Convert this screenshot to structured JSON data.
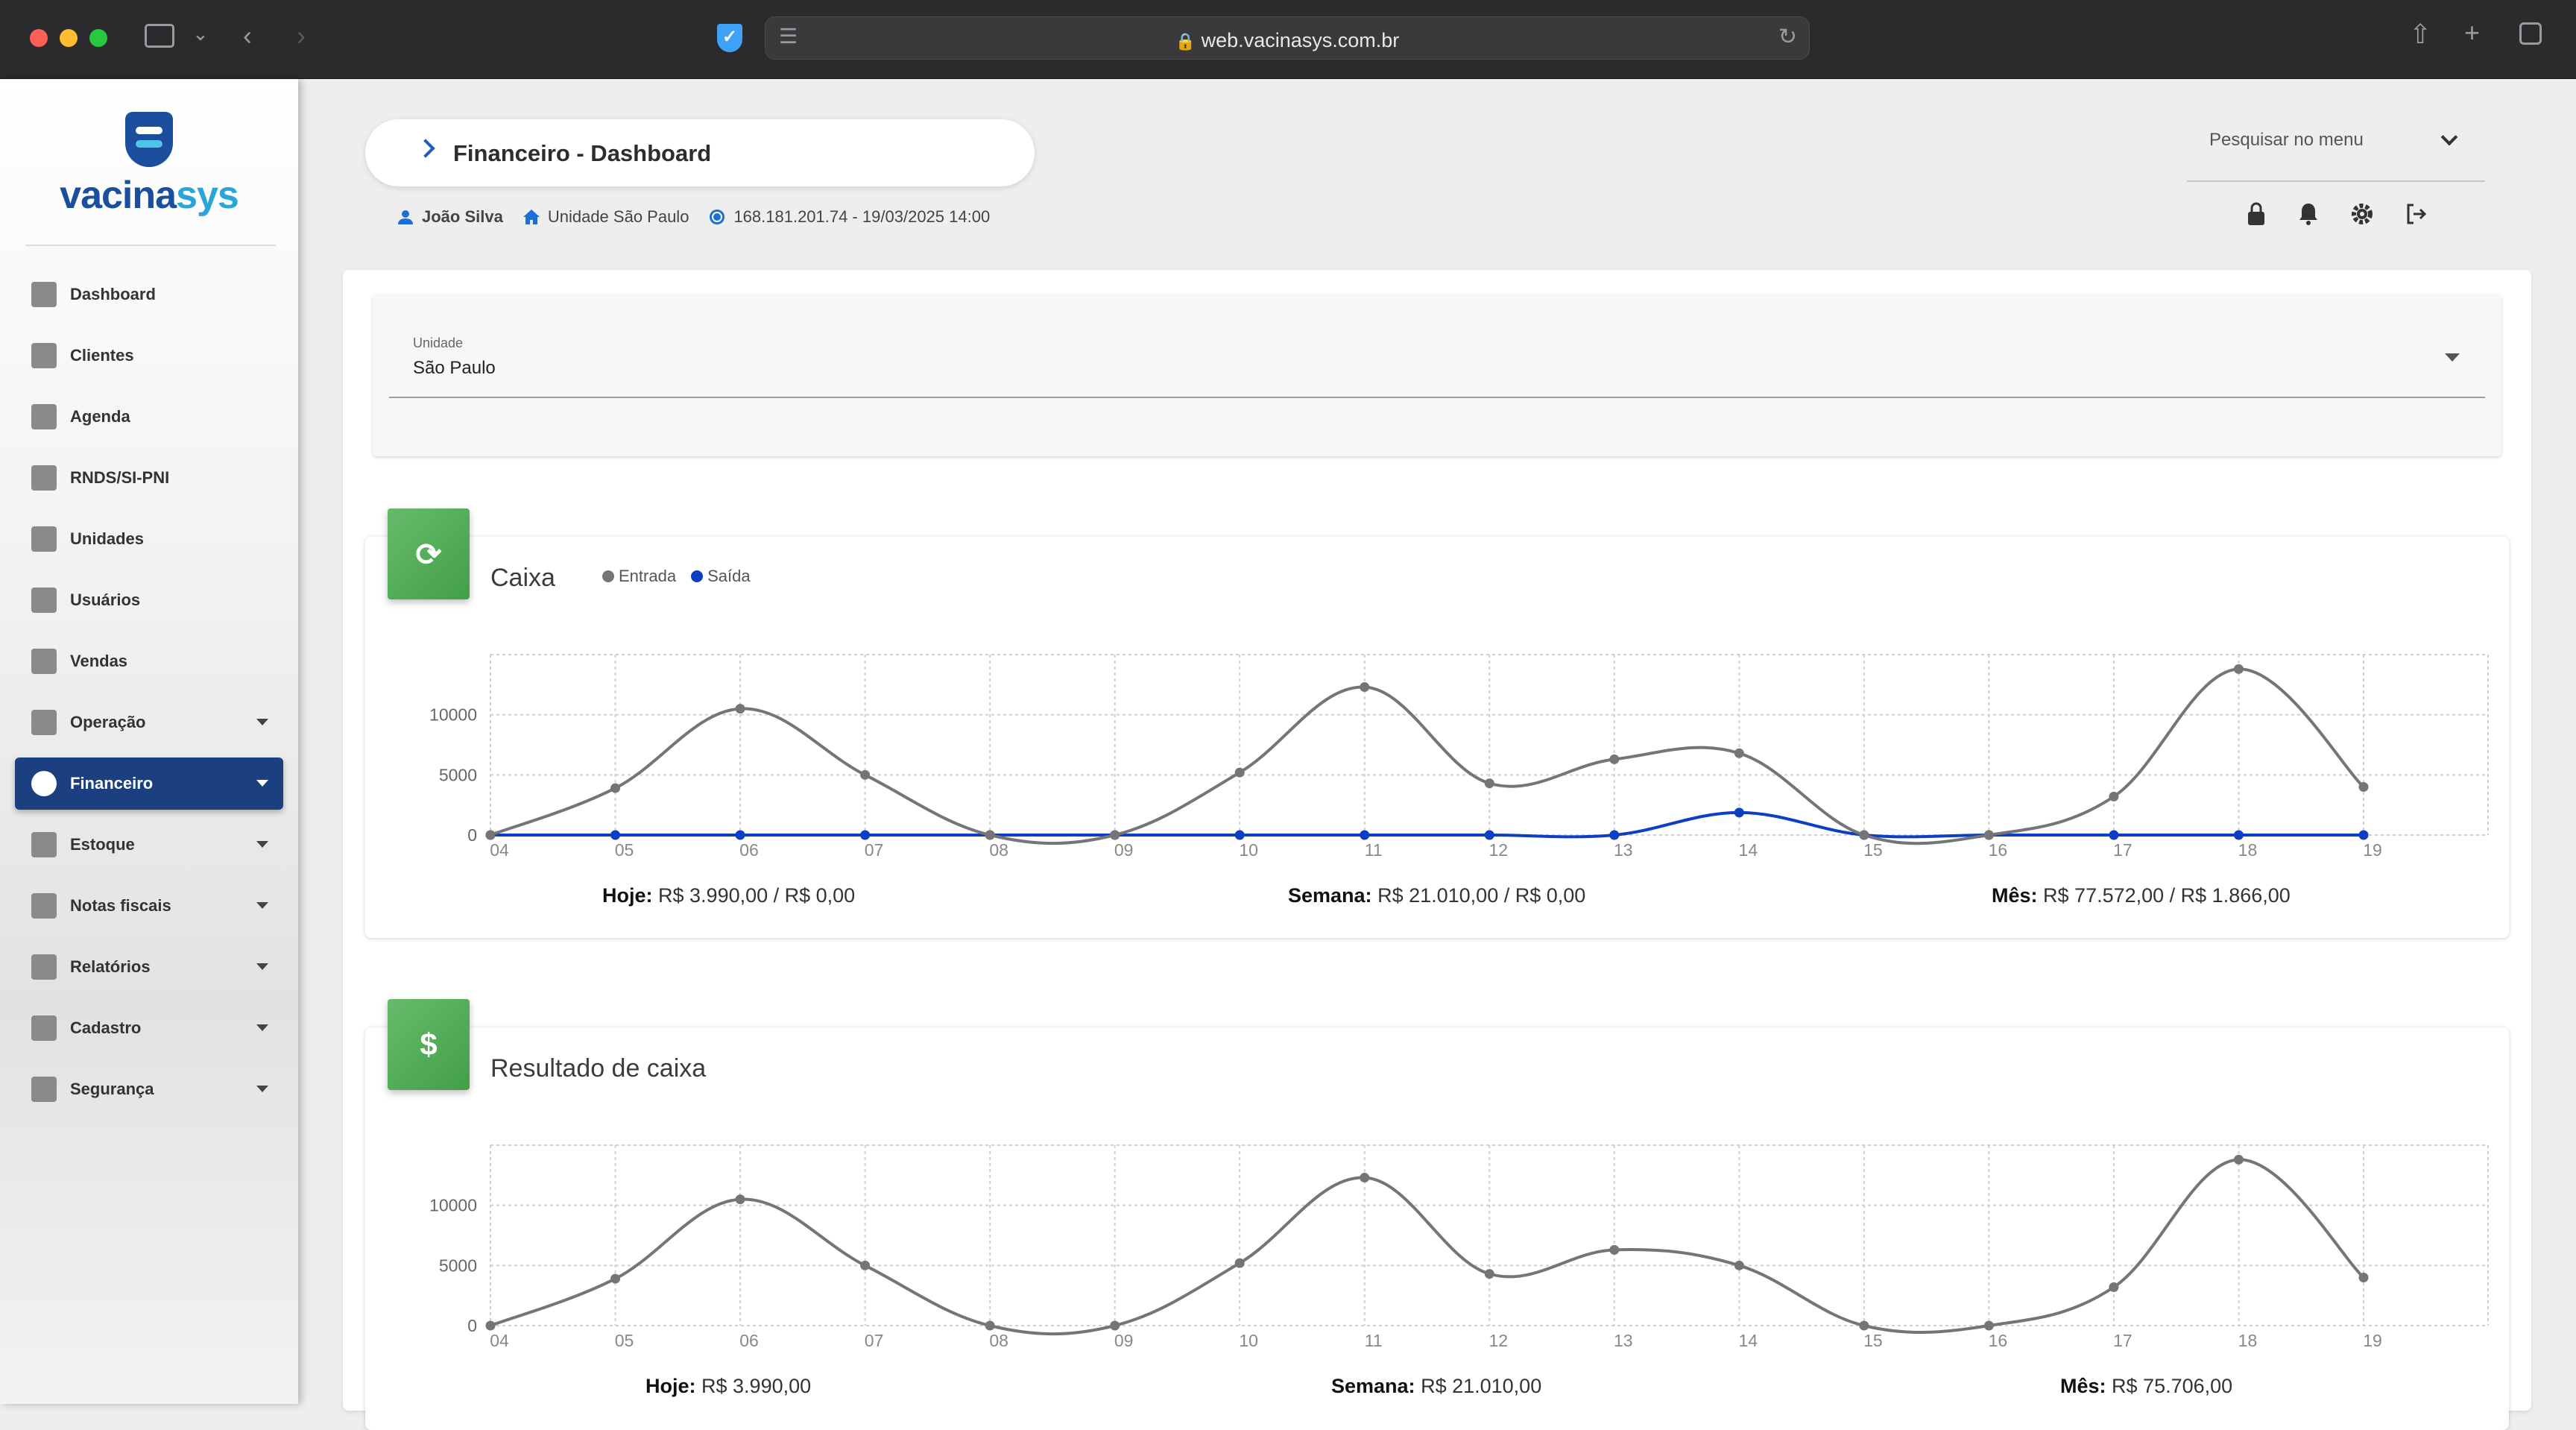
{
  "browser": {
    "url": "web.vacinasys.com.br"
  },
  "logo": {
    "part1": "vacina",
    "part2": "sys"
  },
  "sidebar": {
    "items": [
      {
        "label": "Dashboard"
      },
      {
        "label": "Clientes"
      },
      {
        "label": "Agenda"
      },
      {
        "label": "RNDS/SI-PNI"
      },
      {
        "label": "Unidades"
      },
      {
        "label": "Usuários"
      },
      {
        "label": "Vendas"
      },
      {
        "label": "Operação"
      },
      {
        "label": "Financeiro"
      },
      {
        "label": "Estoque"
      },
      {
        "label": "Notas fiscais"
      },
      {
        "label": "Relatórios"
      },
      {
        "label": "Cadastro"
      },
      {
        "label": "Segurança"
      }
    ],
    "active": "Financeiro"
  },
  "header": {
    "title": "Financeiro - Dashboard",
    "user": "João Silva",
    "unit": "Unidade São Paulo",
    "session": "168.181.201.74 - 19/03/2025 14:00",
    "search_menu_placeholder": "Pesquisar no menu"
  },
  "filter": {
    "unit_label": "Unidade",
    "unit_value": "São Paulo"
  },
  "colors": {
    "entrada": "#757575",
    "saida": "#0d3fc4",
    "badge": "#4caf50",
    "active_nav": "#1c3f80"
  },
  "chart_data": [
    {
      "type": "line",
      "title": "Caixa",
      "categories": [
        "04",
        "05",
        "06",
        "07",
        "08",
        "09",
        "10",
        "11",
        "12",
        "13",
        "14",
        "15",
        "16",
        "17",
        "18",
        "19"
      ],
      "ylim": [
        0,
        15000
      ],
      "yticks": [
        0,
        5000,
        10000
      ],
      "grid": true,
      "legend": "top-left",
      "series": [
        {
          "name": "Entrada",
          "values": [
            0,
            3900,
            10500,
            5000,
            0,
            0,
            5200,
            12300,
            4300,
            6300,
            6800,
            0,
            0,
            3200,
            13800,
            4000
          ]
        },
        {
          "name": "Saída",
          "values": [
            0,
            0,
            0,
            0,
            0,
            0,
            0,
            0,
            0,
            0,
            1866,
            0,
            0,
            0,
            0,
            0
          ]
        }
      ],
      "summary": [
        {
          "label": "Hoje:",
          "value": "R$ 3.990,00 / R$ 0,00"
        },
        {
          "label": "Semana:",
          "value": "R$ 21.010,00 / R$ 0,00"
        },
        {
          "label": "Mês:",
          "value": "R$ 77.572,00 / R$ 1.866,00"
        }
      ]
    },
    {
      "type": "line",
      "title": "Resultado de caixa",
      "categories": [
        "04",
        "05",
        "06",
        "07",
        "08",
        "09",
        "10",
        "11",
        "12",
        "13",
        "14",
        "15",
        "16",
        "17",
        "18",
        "19"
      ],
      "ylim": [
        0,
        15000
      ],
      "yticks": [
        0,
        5000,
        10000
      ],
      "grid": true,
      "series": [
        {
          "values": [
            0,
            3900,
            10500,
            5000,
            0,
            0,
            5200,
            12300,
            4300,
            6300,
            5000,
            0,
            0,
            3200,
            13800,
            4000
          ]
        }
      ],
      "summary": [
        {
          "label": "Hoje:",
          "value": "R$ 3.990,00"
        },
        {
          "label": "Semana:",
          "value": "R$ 21.010,00"
        },
        {
          "label": "Mês:",
          "value": "R$ 75.706,00"
        }
      ]
    }
  ]
}
